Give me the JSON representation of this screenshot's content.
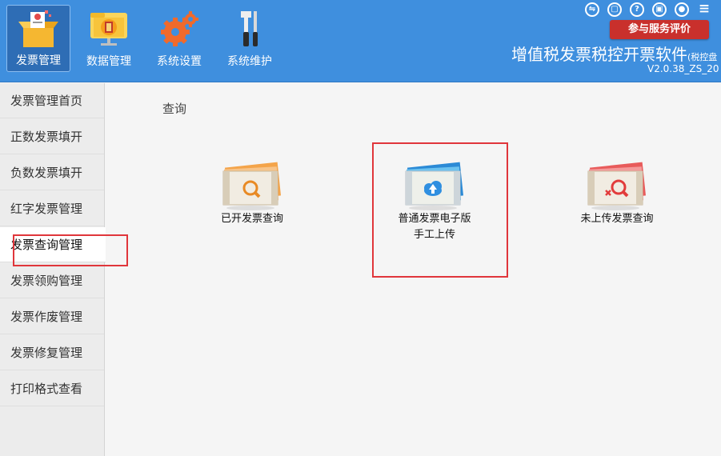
{
  "header": {
    "nav": [
      {
        "label": "发票管理",
        "icon": "invoice-box-icon"
      },
      {
        "label": "数据管理",
        "icon": "folder-monitor-icon"
      },
      {
        "label": "系统设置",
        "icon": "gears-icon"
      },
      {
        "label": "系统维护",
        "icon": "tools-icon"
      }
    ],
    "app_title": "增值税发票税控开票软件",
    "app_title_suffix": "(税控盘",
    "version": "V2.0.38_ZS_20",
    "top_icons": [
      {
        "name": "switch-icon",
        "glyph": "⇋"
      },
      {
        "name": "feedback-icon",
        "glyph": "▢"
      },
      {
        "name": "help-icon",
        "glyph": "?"
      },
      {
        "name": "lock-icon",
        "glyph": "🔒"
      },
      {
        "name": "user-icon",
        "glyph": "●"
      },
      {
        "name": "menu-icon",
        "glyph": "≡"
      }
    ],
    "rate_button": "参与服务评价"
  },
  "sidebar": {
    "items": [
      {
        "label": "发票管理首页"
      },
      {
        "label": "正数发票填开"
      },
      {
        "label": "负数发票填开"
      },
      {
        "label": "红字发票管理"
      },
      {
        "label": "发票查询管理"
      },
      {
        "label": "发票领购管理"
      },
      {
        "label": "发票作废管理"
      },
      {
        "label": "发票修复管理"
      },
      {
        "label": "打印格式查看"
      }
    ],
    "active_index": 4
  },
  "main": {
    "section_label": "查询",
    "tiles": [
      {
        "line1": "已开发票查询",
        "line2": "",
        "icon": "invoice-search-icon"
      },
      {
        "line1": "普通发票电子版",
        "line2": "手工上传",
        "icon": "invoice-cloud-upload-icon"
      },
      {
        "line1": "未上传发票查询",
        "line2": "",
        "icon": "invoice-unuploaded-search-icon"
      }
    ]
  },
  "colors": {
    "header_bg": "#3f8fde",
    "accent_red": "#e0363b",
    "rate_button": "#c9302c"
  }
}
